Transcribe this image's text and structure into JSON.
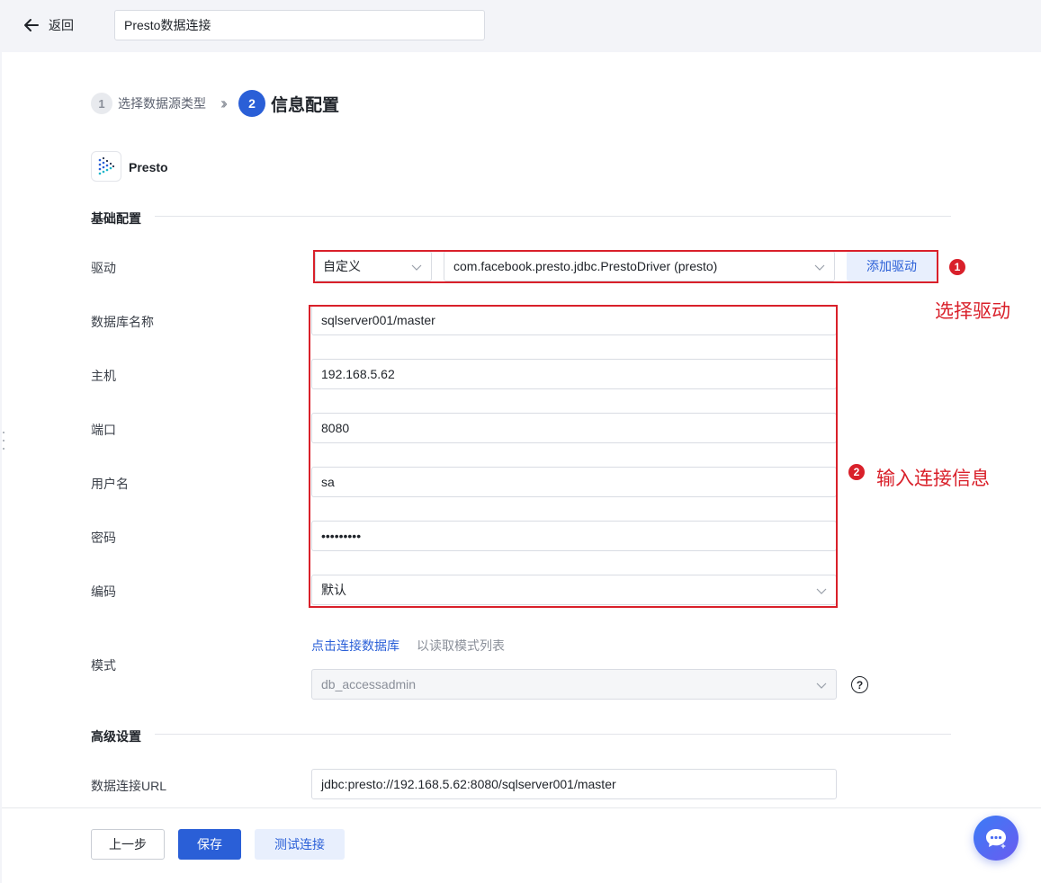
{
  "header": {
    "back_label": "返回",
    "title_value": "Presto数据连接"
  },
  "steps": [
    {
      "number": "1",
      "label": "选择数据源类型"
    },
    {
      "number": "2",
      "label": "信息配置"
    }
  ],
  "datasource": {
    "name": "Presto"
  },
  "sections": {
    "basic": "基础配置",
    "advanced": "高级设置"
  },
  "driver": {
    "label": "驱动",
    "type_value": "自定义",
    "class_value": "com.facebook.presto.jdbc.PrestoDriver (presto)",
    "add_button": "添加驱动"
  },
  "fields": {
    "database": {
      "label": "数据库名称",
      "value": "sqlserver001/master"
    },
    "host": {
      "label": "主机",
      "value": "192.168.5.62"
    },
    "port": {
      "label": "端口",
      "value": "8080"
    },
    "username": {
      "label": "用户名",
      "value": "sa"
    },
    "password": {
      "label": "密码",
      "value": "•••••••••"
    },
    "encoding": {
      "label": "编码",
      "value": "默认"
    }
  },
  "schema": {
    "label": "模式",
    "link": "点击连接数据库",
    "hint": "以读取模式列表",
    "value": "db_accessadmin"
  },
  "url": {
    "label": "数据连接URL",
    "value": "jdbc:presto://192.168.5.62:8080/sqlserver001/master"
  },
  "annotations": [
    {
      "number": "1",
      "text": "选择驱动"
    },
    {
      "number": "2",
      "text": "输入连接信息"
    }
  ],
  "footer": {
    "prev": "上一步",
    "save": "保存",
    "test": "测试连接"
  },
  "colors": {
    "accent": "#2a5fd7",
    "annotation_red": "#d9202a"
  }
}
